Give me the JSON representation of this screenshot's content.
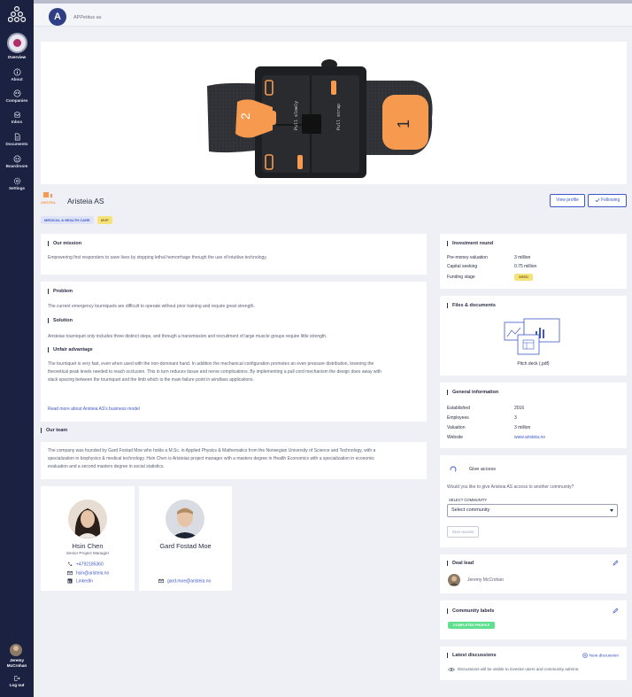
{
  "sidebar": {
    "items": [
      {
        "label": "Overview",
        "icon": "organization-avatar"
      },
      {
        "label": "About",
        "icon": "info-icon"
      },
      {
        "label": "Companies",
        "icon": "companies-icon"
      },
      {
        "label": "Inbox",
        "icon": "inbox-icon"
      },
      {
        "label": "Documents",
        "icon": "document-icon"
      },
      {
        "label": "Boardroom",
        "icon": "boardroom-icon"
      },
      {
        "label": "Settings",
        "icon": "gear-icon"
      }
    ],
    "user_name": "Jeremy McCrohan",
    "logout_label": "Log out"
  },
  "topbar": {
    "company_initial": "A",
    "company_label": "APPetitus as"
  },
  "profile": {
    "name": "Aristeia AS",
    "logo_text": "ARISTEIA",
    "view_profile_label": "View profile",
    "following_label": "Following",
    "tags": [
      "MEDICAL & HEALTH CARE",
      "MVP"
    ]
  },
  "product_image": {
    "left_label": "Pull slowly",
    "right_label": "Pull strap",
    "number_left": "2",
    "number_right": "1"
  },
  "mission": {
    "title": "Our mission",
    "text": "Empowering first responders to save lives by stopping lethal hemorrhage through the use of intuitive technology."
  },
  "business": {
    "problem_title": "Problem",
    "problem_text": "The current emergency tourniquets are difficult to operate without prior training and require great strength.",
    "solution_title": "Solution",
    "solution_text": "Aristeias tourniquet only includes three distinct steps, and through a transmission and recruitment of large muscle groups require little strength.",
    "advantage_title": "Unfair advantage",
    "advantage_lines": [
      "The tourniquet is very fast, even when used with the non-dominant hand. In addition the mechanical configuration promotes an even pressure distribution, lowering the",
      "theoretical peak levels needed to reach occlusion. This in turn reduces tissue and nerve complications. By implementing a pull cord mechanism the design does away with",
      "slack spacing between the tourniquet and the limb which is the main failure point in windlass applications."
    ],
    "read_more": "Read more about Aristeia AS's business model"
  },
  "team": {
    "title": "Our team",
    "lines": [
      "The company was founded by Gard Fostad Moe who holds a M.Sc. in Applied Physics & Mathematics from the Norwegian University of Science and Technology, with a",
      "specialization in biophysics & medical technology. Hsin Chen is Aristeias project manager with a masters degree in Health Economics with a specialization in economic",
      "evaluation and a second masters degree in social statistics."
    ],
    "members": [
      {
        "name": "Hsin Chen",
        "role": "Senior Project Manager",
        "phone": "+4792185360",
        "email": "hsin@aristeia.no",
        "linkedin": "LinkedIn"
      },
      {
        "name": "Gard Fostad Moe",
        "role": "",
        "email": "gard.moe@aristeia.no"
      }
    ]
  },
  "investment": {
    "title": "Investment round",
    "rows": [
      {
        "k": "Pre-money valuation",
        "v": "3 million"
      },
      {
        "k": "Capital seeking",
        "v": "0.75 million"
      },
      {
        "k": "Funding stage",
        "v": "SEED"
      }
    ]
  },
  "files": {
    "title": "Files & documents",
    "file_label": "Pitch deck (.pdf)"
  },
  "general": {
    "title": "General information",
    "rows": [
      {
        "k": "Established",
        "v": "2016"
      },
      {
        "k": "Employees",
        "v": "3"
      },
      {
        "k": "Valuation",
        "v": "3 million"
      },
      {
        "k": "Website",
        "v": "www.aristeia.no"
      }
    ]
  },
  "access": {
    "title": "Give access",
    "question": "Would you like to give Aristeia AS access to another community?",
    "select_label": "SELECT COMMUNITY",
    "select_value": "Select community",
    "button_label": "Give access"
  },
  "deal_lead": {
    "title": "Deal lead",
    "name": "Jeremy McCrohan"
  },
  "labels": {
    "title": "Community labels",
    "badge": "COMPLETED PROFILE"
  },
  "discussions": {
    "title": "Latest discussions",
    "new_label": "New discussion",
    "note": "Discussions will be visible to investor users and community admins."
  },
  "colors": {
    "sidebar": "#1b2140",
    "accent": "#3e57c7",
    "product_orange": "#f59a4f",
    "seed_badge": "#f6e27a",
    "green_badge": "#5fe08f"
  }
}
